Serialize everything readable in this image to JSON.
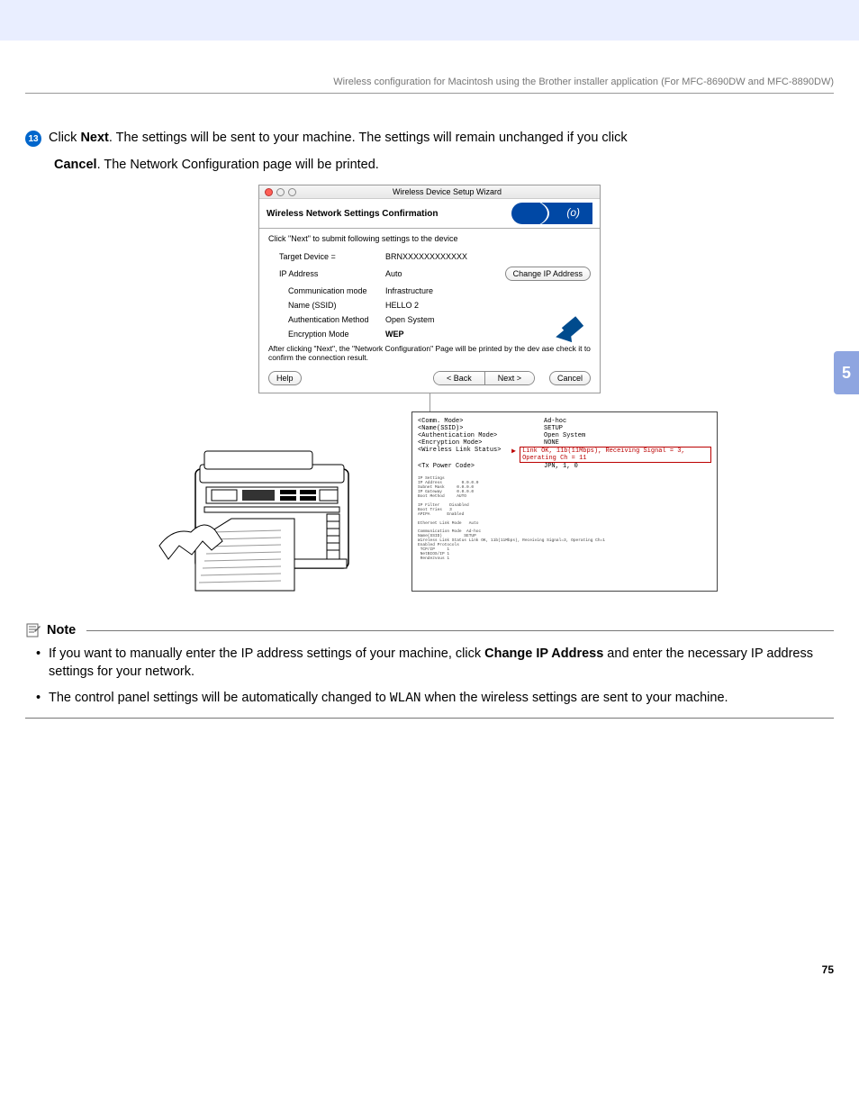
{
  "header": "Wireless configuration for Macintosh using the Brother installer application (For MFC-8690DW and MFC-8890DW)",
  "step": {
    "number": "13",
    "pre": "Click ",
    "bold1": "Next",
    "mid": ". The settings will be sent to your machine. The settings will remain unchanged if you click ",
    "bold2": "Cancel",
    "post": ". The Network Configuration page will be printed."
  },
  "dialog": {
    "window_title": "Wireless Device Setup Wizard",
    "title": "Wireless Network Settings Confirmation",
    "instruction": "Click \"Next\" to submit following settings to the device",
    "rows": {
      "target_label": "Target Device =",
      "target_value": "BRNXXXXXXXXXXXX",
      "ip_label": "IP Address",
      "ip_value": "Auto",
      "change_ip": "Change IP Address",
      "comm_label": "Communication mode",
      "comm_value": "Infrastructure",
      "ssid_label": "Name (SSID)",
      "ssid_value": "HELLO 2",
      "auth_label": "Authentication Method",
      "auth_value": "Open System",
      "enc_label": "Encryption Mode",
      "enc_value": "WEP"
    },
    "postnote": "After clicking \"Next\", the \"Network Configuration\" Page will be printed by the dev       ase check it to confirm the connection result.",
    "buttons": {
      "help": "Help",
      "back": "< Back",
      "next": "Next >",
      "cancel": "Cancel"
    }
  },
  "config_print": {
    "l1k": "<Comm. Mode>",
    "l1v": "Ad-hoc",
    "l2k": "<Name(SSID)>",
    "l2v": "SETUP",
    "l3k": "<Authentication Mode>",
    "l3v": "Open System",
    "l4k": "<Encryption Mode>",
    "l4v": "NONE",
    "l5k": "<Wireless Link Status>",
    "l5v": "Link OK, 11b(11Mbps), Receiving Signal = 3, Operating Ch = 11",
    "l6k": "<Tx Power Code>",
    "l6v": "JPN, 1, 0"
  },
  "note": {
    "title": "Note",
    "item1_pre": "If you want to manually enter the IP address settings of your machine, click ",
    "item1_bold": "Change IP Address",
    "item1_post": " and enter the necessary IP address settings for your network.",
    "item2_pre": "The control panel settings will be automatically changed to ",
    "item2_mono": "WLAN",
    "item2_post": " when the wireless settings are sent to your machine."
  },
  "chapter_tab": "5",
  "page_number": "75"
}
